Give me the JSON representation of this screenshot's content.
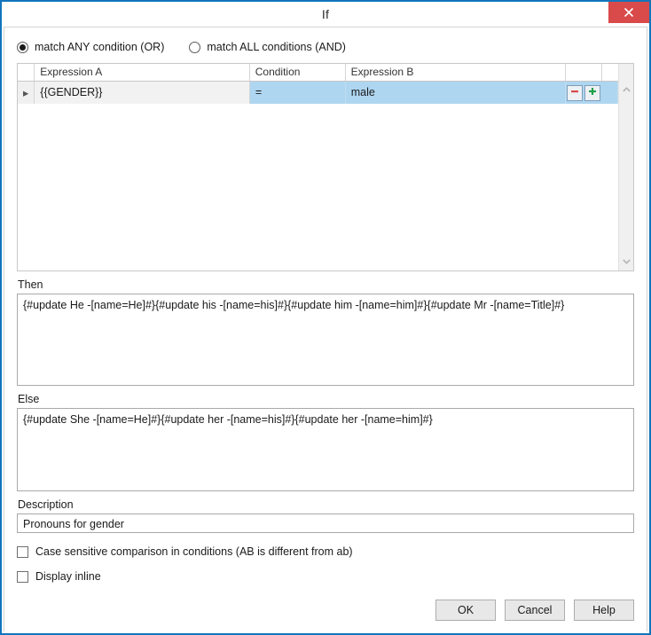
{
  "window": {
    "title": "If",
    "close_icon": "close-icon"
  },
  "match_mode": {
    "options": [
      {
        "label": "match ANY condition (OR)",
        "selected": true
      },
      {
        "label": "match ALL conditions (AND)",
        "selected": false
      }
    ]
  },
  "conditions_grid": {
    "columns": [
      "",
      "Expression A",
      "Condition",
      "Expression B",
      "",
      ""
    ],
    "rows": [
      {
        "indicator": "▸",
        "expression_a": "{{GENDER}}",
        "condition": "=",
        "expression_b": "male",
        "remove_label": "−",
        "add_label": "+"
      }
    ],
    "scrollbar": {
      "up_arrow": "chevron-up-icon",
      "down_arrow": "chevron-down-icon"
    }
  },
  "then": {
    "label": "Then",
    "value": "{#update He -[name=He]#}{#update his -[name=his]#}{#update him -[name=him]#}{#update Mr -[name=Title]#}"
  },
  "else": {
    "label": "Else",
    "value": "{#update She -[name=He]#}{#update her -[name=his]#}{#update her -[name=him]#}"
  },
  "description": {
    "label": "Description",
    "value": "Pronouns for gender"
  },
  "checkboxes": [
    {
      "label": "Case sensitive comparison in conditions (AB is different from ab)",
      "checked": false
    },
    {
      "label": "Display inline",
      "checked": false
    }
  ],
  "footer": {
    "ok_label": "OK",
    "cancel_label": "Cancel",
    "help_label": "Help"
  },
  "colors": {
    "window_border": "#1275bc",
    "close_button": "#d94a4a",
    "row_selection": "#aed6f1",
    "remove_icon": "#d94a4a",
    "add_icon": "#21a04a"
  }
}
